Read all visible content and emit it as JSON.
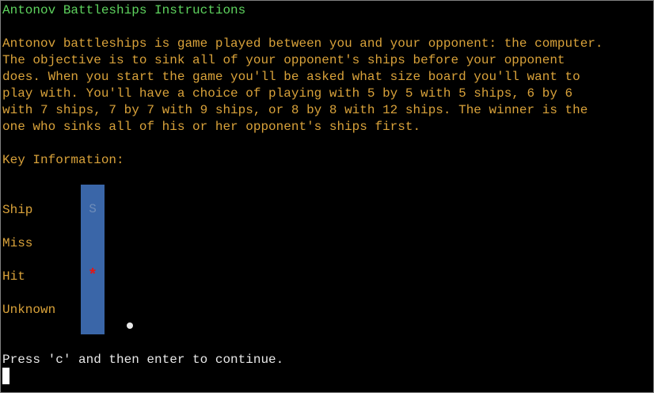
{
  "title": "Antonov Battleships Instructions",
  "intro_lines": [
    "Antonov battleships is game played between you and your opponent: the computer.",
    "The objective is to sink all of your opponent's ships before your opponent",
    "does. When you start the game you'll be asked what size board you'll want to",
    "play with. You'll have a choice of playing with 5 by 5 with 5 ships, 6 by 6",
    "with 7 ships, 7 by 7 with 9 ships, or 8 by 8 with 12 ships. The winner is the",
    "one who sinks all of his or her opponent's ships first."
  ],
  "key_heading": "Key Information:",
  "legend": {
    "ship_label": "Ship",
    "ship_symbol": "S",
    "miss_label": "Miss",
    "miss_symbol": "",
    "hit_label": "Hit",
    "hit_symbol": "*",
    "unknown_label": "Unknown",
    "unknown_icon": "filled-circle"
  },
  "prompt": "Press 'c' and then enter to continue.",
  "colors": {
    "title": "#5ed35e",
    "text": "#d9a23a",
    "prompt": "#e8e8e8",
    "legend_background": "#3a66a8",
    "hit": "#e01818"
  }
}
